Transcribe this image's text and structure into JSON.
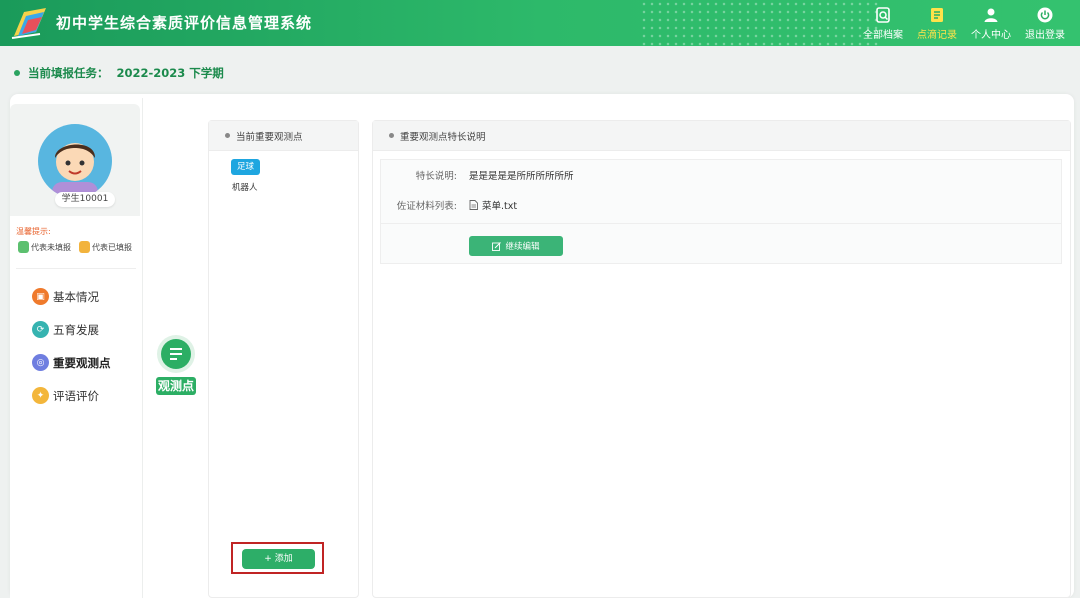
{
  "header": {
    "app_title": "初中学生综合素质评价信息管理系统",
    "nav": [
      {
        "label": "全部档案",
        "icon": "archive-search-icon"
      },
      {
        "label": "点滴记录",
        "icon": "notebook-icon",
        "active": true
      },
      {
        "label": "个人中心",
        "icon": "user-icon"
      },
      {
        "label": "退出登录",
        "icon": "power-icon"
      }
    ]
  },
  "task": {
    "label": "当前填报任务：",
    "value": "2022-2023 下学期"
  },
  "student": {
    "name": "学生10001",
    "hint_title": "温馨提示:",
    "legend_unfilled": "代表未填报",
    "legend_filled": "代表已填报",
    "menu": [
      {
        "label": "基本情况",
        "color": "#ef7a2c"
      },
      {
        "label": "五育发展",
        "color": "#36b3b0"
      },
      {
        "label": "重要观测点",
        "color": "#6f7ee0",
        "active": true
      },
      {
        "label": "评语评价",
        "color": "#f3b63b"
      }
    ]
  },
  "tab": {
    "label": "观测点"
  },
  "list": {
    "title": "当前重要观测点",
    "items": [
      "足球",
      "机器人"
    ],
    "add_label": "+ 添加"
  },
  "detail": {
    "title": "重要观测点特长说明",
    "specialty_label": "特长说明:",
    "specialty_value": "是是是是是所所所所所所",
    "materials_label": "佐证材料列表:",
    "material_file": "菜单.txt",
    "edit_label": "继续编辑"
  },
  "colors": {
    "brand": "#2cae64",
    "tag": "#1ea6e0",
    "highlight_border": "#c02424"
  }
}
